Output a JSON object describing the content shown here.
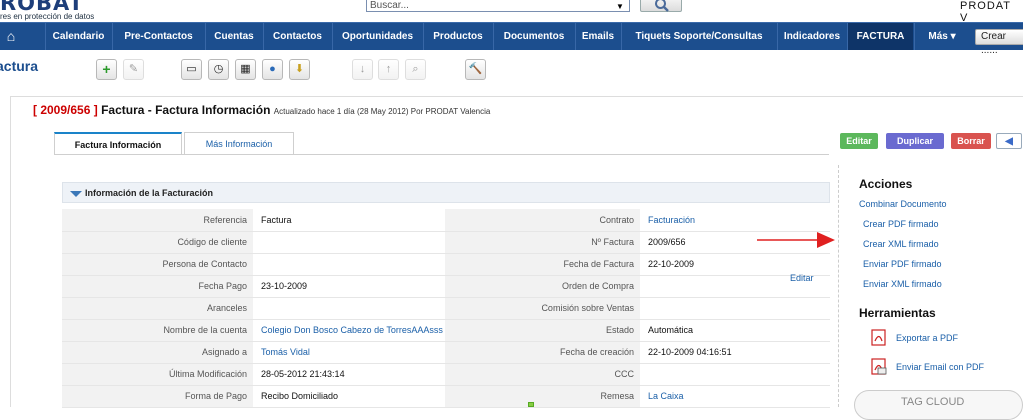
{
  "header": {
    "logo": "ROBAT",
    "tagline": "res en protección de datos",
    "search_placeholder": "Buscar...",
    "user": "PRODAT V"
  },
  "nav": {
    "items": [
      "Calendario",
      "Pre-Contactos",
      "Cuentas",
      "Contactos",
      "Oportunidades",
      "Productos",
      "Documentos",
      "Emails",
      "Tiquets Soporte/Consultas",
      "Indicadores",
      "FACTURA",
      "Más ▾"
    ],
    "active": "FACTURA",
    "crear": "Crear ......"
  },
  "module": {
    "title": "actura"
  },
  "record": {
    "id": "[ 2009/656 ]",
    "title": "Factura - Factura Información",
    "updated": "Actualizado hace 1 día (28 May 2012) Por PRODAT Valencia"
  },
  "tabs": [
    "Factura Información",
    "Más Información"
  ],
  "actions": {
    "edit": "Editar",
    "duplicate": "Duplicar",
    "delete": "Borrar"
  },
  "section": {
    "title": "Información de la Facturación",
    "edit_link": "Editar"
  },
  "fields": {
    "r0": {
      "l1": "Referencia",
      "v1": "Factura",
      "l2": "Contrato",
      "v2": "Facturación"
    },
    "r1": {
      "l1": "Código de cliente",
      "v1": "",
      "l2": "Nº Factura",
      "v2": "2009/656"
    },
    "r2": {
      "l1": "Persona de Contacto",
      "v1": "",
      "l2": "Fecha de Factura",
      "v2": "22-10-2009"
    },
    "r3": {
      "l1": "Fecha Pago",
      "v1": "23-10-2009",
      "l2": "Orden de Compra",
      "v2": ""
    },
    "r4": {
      "l1": "Aranceles",
      "v1": "",
      "l2": "Comisión sobre Ventas",
      "v2": ""
    },
    "r5": {
      "l1": "Nombre de la cuenta",
      "v1": "Colegio Don Bosco Cabezo de TorresAAAsss",
      "l2": "Estado",
      "v2": "Automática"
    },
    "r6": {
      "l1": "Asignado a",
      "v1": "Tomás Vidal",
      "l2": "Fecha de creación",
      "v2": "22-10-2009 04:16:51"
    },
    "r7": {
      "l1": "Última Modificación",
      "v1": "28-05-2012 21:43:14",
      "l2": "CCC",
      "v2": ""
    },
    "r8": {
      "l1": "Forma de Pago",
      "v1": "Recibo Domiciliado",
      "l2": "Remesa",
      "v2": "La Caixa"
    }
  },
  "sidebar": {
    "acciones_title": "Acciones",
    "acciones": [
      "Combinar Documento",
      "Crear PDF firmado",
      "Crear XML firmado",
      "Enviar PDF firmado",
      "Enviar XML firmado"
    ],
    "herramientas_title": "Herramientas",
    "herramientas": [
      "Exportar a PDF",
      "Enviar Email con PDF"
    ],
    "tag_cloud": "TAG CLOUD"
  }
}
